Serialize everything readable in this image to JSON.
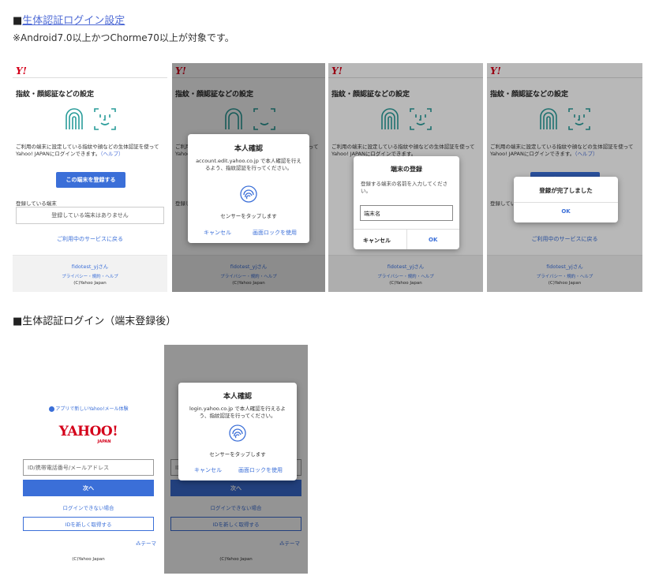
{
  "section1": {
    "prefix": "■",
    "link_text": "生体認証ログイン設定",
    "note": "※Android7.0以上かつChorme70以上が対象です。"
  },
  "setup_screen": {
    "logo": "Y!",
    "title": "指紋・顔認証などの設定",
    "description": "ご利用の端末に設定している指紋や顔などの生体認証を使ってYahoo! JAPANにログインできます。",
    "help": "（ヘルプ）",
    "register_button": "この端末を登録する",
    "registered_label": "登録している端末",
    "no_device": "登録している端末はありません",
    "back_link": "ご利用中のサービスに戻る",
    "user": "fidotest_yjさん",
    "footer_links": "プライバシー・規約・ヘルプ",
    "copyright": "(C)Yahoo Japan"
  },
  "dialog_verify1": {
    "title": "本人確認",
    "body": "account.edit.yahoo.co.jp で本人確認を行えるよう、指紋認証を行ってください。",
    "sensor": "センサーをタップします",
    "cancel": "キャンセル",
    "screen_lock": "画面ロックを使用"
  },
  "dialog_register": {
    "title": "端末の登録",
    "body": "登録する端末の名前を入力してください。",
    "input_value": "端末名",
    "cancel": "キャンセル",
    "ok": "OK"
  },
  "dialog_done": {
    "title": "登録が完了しました",
    "ok": "OK"
  },
  "section2": {
    "heading": "■生体認証ログイン（端末登録後）"
  },
  "login_screen": {
    "promo": "アプリで新しいYahoo!メール体験",
    "logo": "YAHOO!",
    "logo_sub": "JAPAN",
    "id_placeholder": "ID/携帯電話番号/メールアドレス",
    "next": "次へ",
    "cant_login": "ログインできない場合",
    "new_id": "IDを新しく取得する",
    "theme": "テーマ",
    "copyright": "(C)Yahoo Japan"
  },
  "dialog_verify2": {
    "title": "本人確認",
    "body": "login.yahoo.co.jp で本人確認を行えるよう、指紋認証を行ってください。",
    "sensor": "センサーをタップします",
    "cancel": "キャンセル",
    "screen_lock": "画面ロックを使用"
  },
  "colors": {
    "accent": "#3b6fd8",
    "brand": "#d4001a",
    "icon_teal": "#2a9d9a"
  }
}
